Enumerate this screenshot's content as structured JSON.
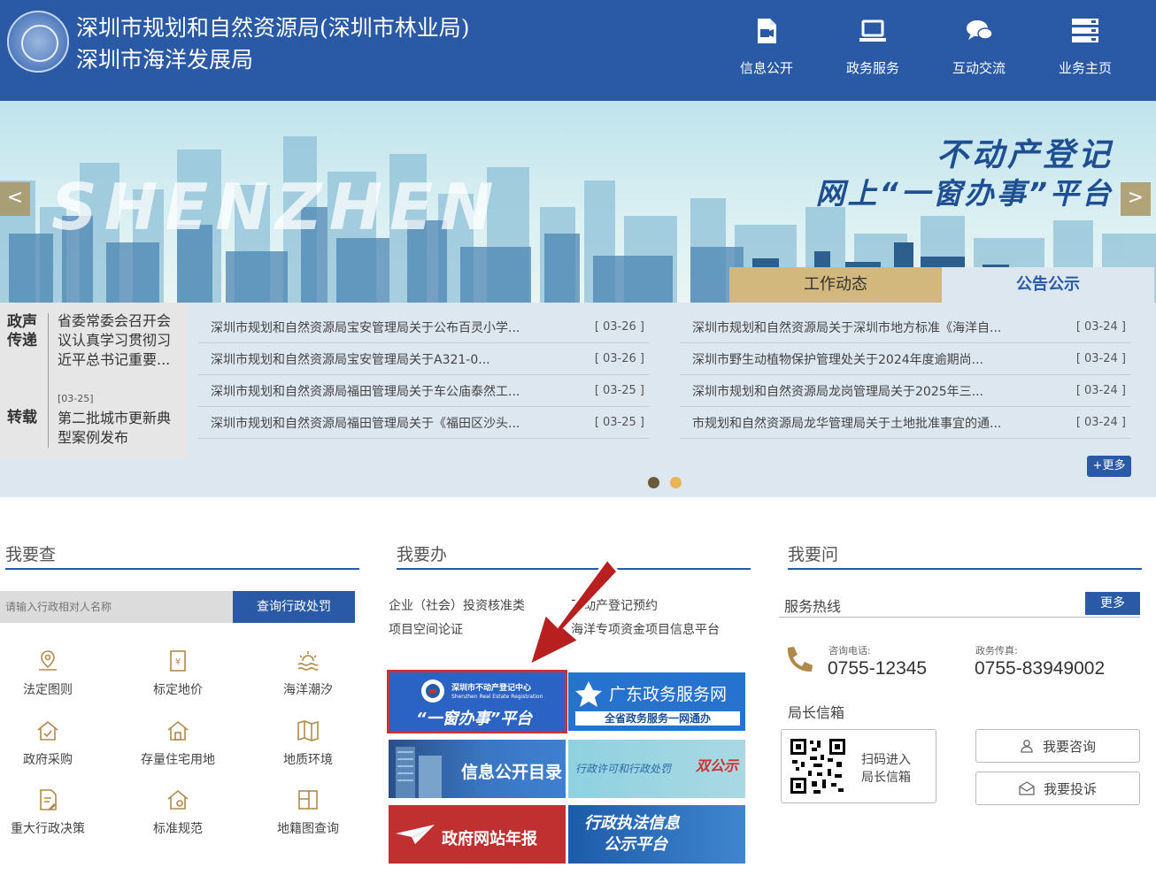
{
  "header": {
    "title_line1": "深圳市规划和自然资源局(深圳市林业局)",
    "title_line2": "深圳市海洋发展局",
    "nav": [
      {
        "label": "信息公开",
        "icon": "document-video-icon"
      },
      {
        "label": "政务服务",
        "icon": "laptop-icon"
      },
      {
        "label": "互动交流",
        "icon": "chat-bubbles-icon"
      },
      {
        "label": "业务主页",
        "icon": "server-stack-icon"
      }
    ]
  },
  "banner": {
    "watermark": "SHENZHEN",
    "title1": "不动产登记",
    "title2": "网上“一窗办事”平台",
    "prev": "<",
    "next": ">"
  },
  "news": {
    "tabs": [
      "工作动态",
      "公告公示"
    ],
    "side": {
      "label1": "政声传递",
      "item1": "省委常委会召开会议认真学习贯彻习近平总书记重要...",
      "date1": "[03-25]",
      "label2": "转载",
      "item2": "第二批城市更新典型案例发布"
    },
    "left": [
      {
        "title": "深圳市规划和自然资源局宝安管理局关于公布百灵小学...",
        "date": "[ 03-26 ]"
      },
      {
        "title": "深圳市规划和自然资源局宝安管理局关于A321-0...",
        "date": "[ 03-26 ]"
      },
      {
        "title": "深圳市规划和自然资源局福田管理局关于车公庙泰然工...",
        "date": "[ 03-25 ]"
      },
      {
        "title": "深圳市规划和自然资源局福田管理局关于《福田区沙头...",
        "date": "[ 03-25 ]"
      }
    ],
    "right": [
      {
        "title": "深圳市规划和自然资源局关于深圳市地方标准《海洋自...",
        "date": "[ 03-24 ]"
      },
      {
        "title": "深圳市野生动植物保护管理处关于2024年度逾期尚...",
        "date": "[ 03-24 ]"
      },
      {
        "title": "深圳市规划和自然资源局龙岗管理局关于2025年三...",
        "date": "[ 03-24 ]"
      },
      {
        "title": "市规划和自然资源局龙华管理局关于土地批准事宜的通...",
        "date": "[ 03-24 ]"
      }
    ],
    "more": "+更多"
  },
  "chazha": {
    "title": "我要查",
    "search_placeholder": "请输入行政相对人名称",
    "search_button": "查询行政处罚",
    "items": [
      {
        "label": "法定图则",
        "icon": "map-pin-icon"
      },
      {
        "label": "标定地价",
        "icon": "price-document-icon"
      },
      {
        "label": "海洋潮汐",
        "icon": "sunrise-waves-icon"
      },
      {
        "label": "政府采购",
        "icon": "house-check-icon"
      },
      {
        "label": "存量住宅用地",
        "icon": "house-stock-icon"
      },
      {
        "label": "地质环境",
        "icon": "folded-map-icon"
      },
      {
        "label": "重大行政决策",
        "icon": "document-edit-icon"
      },
      {
        "label": "标准规范",
        "icon": "house-gear-icon"
      },
      {
        "label": "地籍图查询",
        "icon": "grid-map-icon"
      }
    ]
  },
  "ban": {
    "title": "我要办",
    "link1": "企业（社会）投资核准类",
    "link2": "项目空间论证",
    "link3": "不动产登记预约",
    "link4": "海洋专项资金项目信息平台",
    "tiles": {
      "yichuang_small": "深圳市不动产登记中心",
      "yichuang_en": "Shenzhen Real Estate Registration",
      "yichuang_main": "“一窗办事”平台",
      "guangdong_main": "广东政务服务网",
      "guangdong_sub": "全省政务服务一网通办",
      "xinxi": "信息公开目录",
      "shuanggongshi_left": "行政许可和行政处罚",
      "shuanggongshi_right": "双公示",
      "nianbao": "政府网站年报",
      "zhifa_line1": "行政执法信息",
      "zhifa_line2": "公示平台"
    }
  },
  "wen": {
    "title": "我要问",
    "hotline_title": "服务热线",
    "hotline_more": "更多",
    "phone_label": "咨询电话:",
    "phone": "0755-12345",
    "fax_label": "政务传真:",
    "fax": "0755-83949002",
    "mailbox_title": "局长信箱",
    "qr_text1": "扫码进入",
    "qr_text2": "局长信箱",
    "consult": "我要咨询",
    "complain": "我要投诉"
  },
  "colors": {
    "header_blue": "#2a5aa5",
    "accent_gold": "#d3b87e",
    "highlight_red": "#d03030",
    "arrow_red": "#b82020"
  }
}
